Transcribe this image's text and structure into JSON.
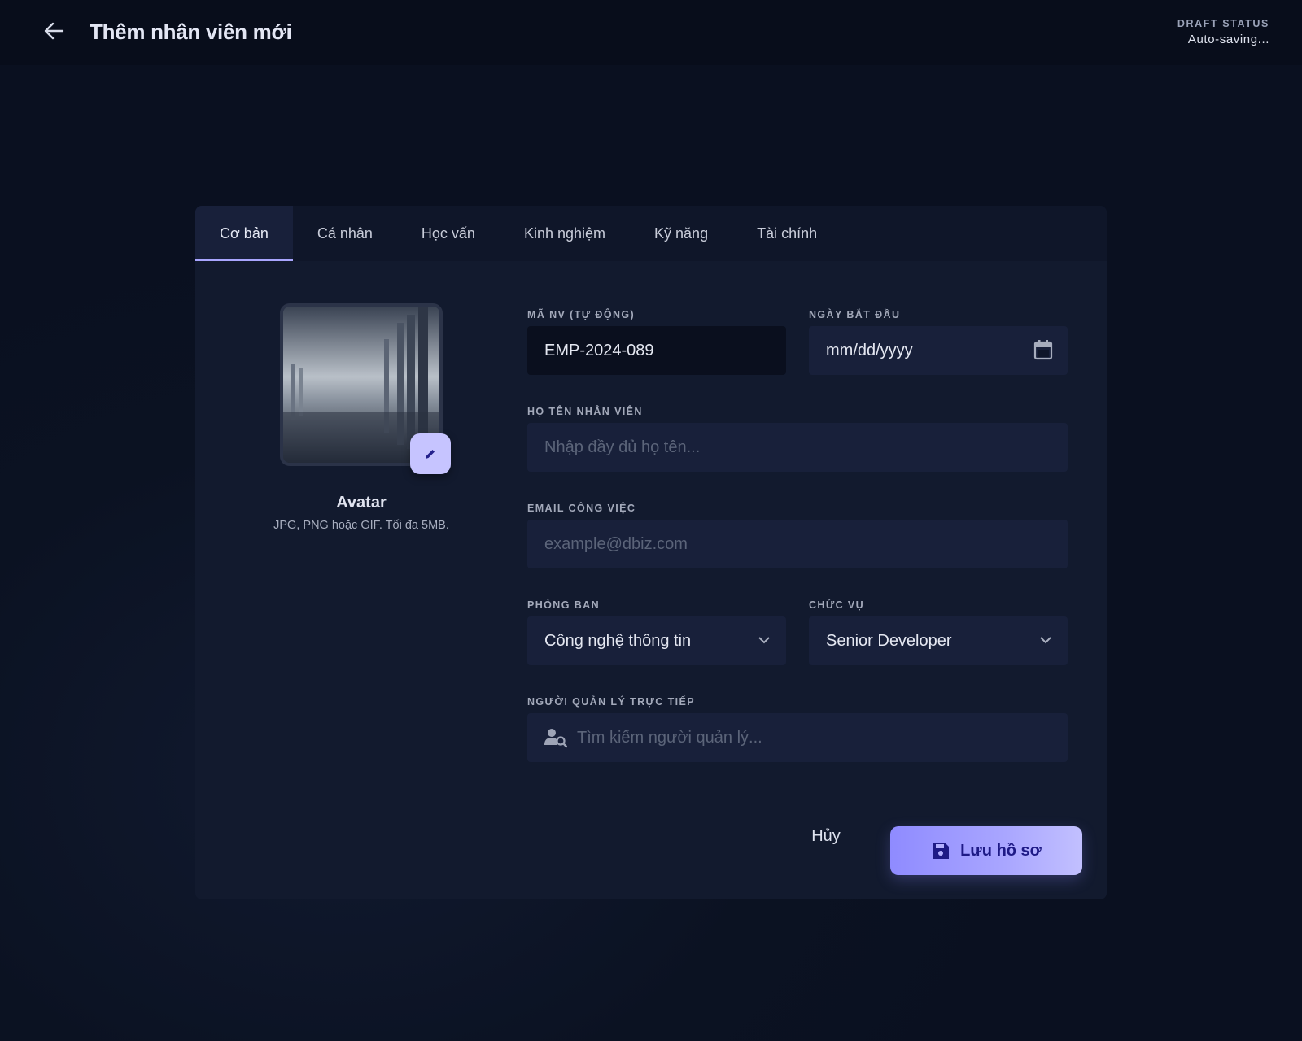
{
  "header": {
    "title": "Thêm nhân viên mới",
    "draft_label": "DRAFT STATUS",
    "draft_value": "Auto-saving..."
  },
  "tabs": [
    {
      "label": "Cơ bản",
      "active": true
    },
    {
      "label": "Cá nhân",
      "active": false
    },
    {
      "label": "Học vấn",
      "active": false
    },
    {
      "label": "Kinh nghiệm",
      "active": false
    },
    {
      "label": "Kỹ năng",
      "active": false
    },
    {
      "label": "Tài chính",
      "active": false
    }
  ],
  "avatar": {
    "title": "Avatar",
    "hint": "JPG, PNG hoặc GIF. Tối đa 5MB."
  },
  "form": {
    "employee_id": {
      "label": "MÃ NV (TỰ ĐỘNG)",
      "value": "EMP-2024-089"
    },
    "start_date": {
      "label": "NGÀY BẮT ĐẦU",
      "placeholder": "mm/dd/yyyy"
    },
    "full_name": {
      "label": "HỌ TÊN NHÂN VIÊN",
      "placeholder": "Nhập đầy đủ họ tên..."
    },
    "email": {
      "label": "EMAIL CÔNG VIỆC",
      "placeholder": "example@dbiz.com"
    },
    "department": {
      "label": "PHÒNG BAN",
      "value": "Công nghệ thông tin"
    },
    "position": {
      "label": "CHỨC VỤ",
      "value": "Senior Developer"
    },
    "manager": {
      "label": "NGƯỜI QUẢN LÝ TRỰC TIẾP",
      "placeholder": "Tìm kiếm người quản lý..."
    }
  },
  "actions": {
    "cancel": "Hủy",
    "save": "Lưu hồ sơ"
  },
  "colors": {
    "accent": "#a9a6ff",
    "background": "#0b1222",
    "card": "#121a2e"
  }
}
